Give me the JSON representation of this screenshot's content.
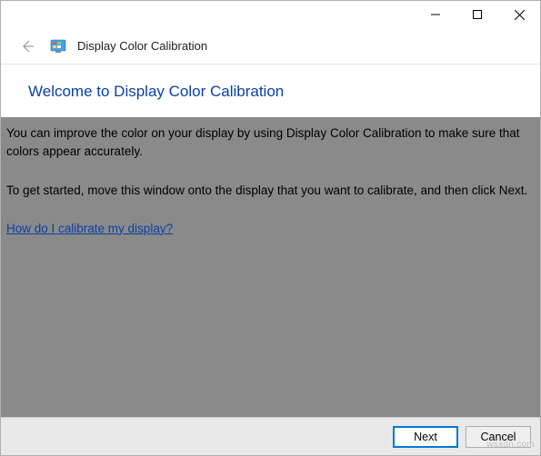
{
  "window": {
    "title": "Display Color Calibration"
  },
  "header": {
    "back_label": "Back",
    "icon_name": "display-color-icon",
    "title": "Display Color Calibration"
  },
  "content": {
    "heading": "Welcome to Display Color Calibration",
    "paragraph1": "You can improve the color on your display by using Display Color Calibration to make sure that colors appear accurately.",
    "paragraph2": "To get started, move this window onto the display that you want to calibrate, and then click Next.",
    "help_link": "How do I calibrate my display?"
  },
  "footer": {
    "next_label": "Next",
    "cancel_label": "Cancel"
  },
  "watermark": "wsxdn.com"
}
